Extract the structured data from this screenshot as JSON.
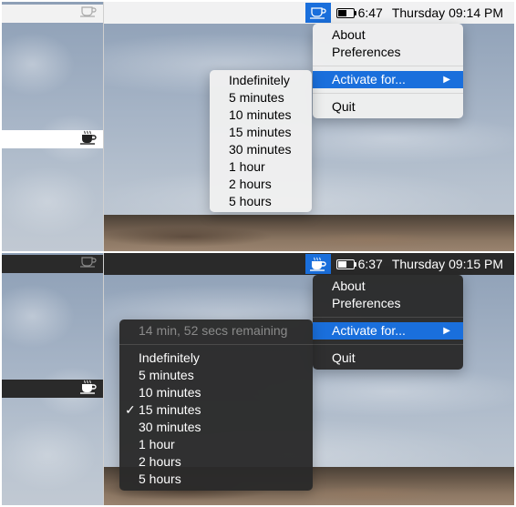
{
  "top": {
    "menubar": {
      "time_left": "6:47",
      "clock": "Thursday 09:14 PM"
    },
    "menu": {
      "about": "About",
      "preferences": "Preferences",
      "activate": "Activate for...",
      "quit": "Quit"
    },
    "submenu": {
      "items": [
        "Indefinitely",
        "5 minutes",
        "10 minutes",
        "15 minutes",
        "30 minutes",
        "1 hour",
        "2 hours",
        "5 hours"
      ]
    }
  },
  "bottom": {
    "menubar": {
      "time_left": "6:37",
      "clock": "Thursday 09:15 PM"
    },
    "menu": {
      "about": "About",
      "preferences": "Preferences",
      "activate": "Activate for...",
      "quit": "Quit"
    },
    "submenu": {
      "status": "14 min, 52 secs remaining",
      "items": [
        "Indefinitely",
        "5 minutes",
        "10 minutes",
        "15 minutes",
        "30 minutes",
        "1 hour",
        "2 hours",
        "5 hours"
      ],
      "checked_index": 3,
      "check_mark": "✓"
    }
  },
  "colors": {
    "highlight": "#1a6fdc",
    "dark_menu": "#2a2a2a"
  }
}
